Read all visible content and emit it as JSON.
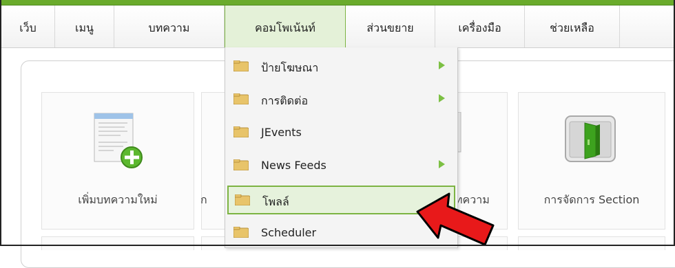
{
  "menu": {
    "items": [
      {
        "label": "เว็บ"
      },
      {
        "label": "เมนู"
      },
      {
        "label": "บทความ"
      },
      {
        "label": "คอมโพเน้นท์"
      },
      {
        "label": "ส่วนขยาย"
      },
      {
        "label": "เครื่องมือ"
      },
      {
        "label": "ช่วยเหลือ"
      }
    ],
    "active_index": 3
  },
  "dropdown": {
    "items": [
      {
        "label": "ป้ายโฆษณา",
        "submenu": true
      },
      {
        "label": "การติดต่อ",
        "submenu": true
      },
      {
        "label": "JEvents",
        "submenu": false
      },
      {
        "label": "News Feeds",
        "submenu": true
      },
      {
        "label": "โพลล์",
        "submenu": false,
        "highlighted": true
      },
      {
        "label": "Scheduler",
        "submenu": false
      }
    ]
  },
  "tiles": [
    {
      "label": "เพิ่มบทความใหม่",
      "icon": "new-article-icon"
    },
    {
      "label": "ก",
      "icon": ""
    },
    {
      "label": "ทความ",
      "icon": "article-manager-icon"
    },
    {
      "label": "การจัดการ Section",
      "icon": "section-manager-icon"
    }
  ],
  "colors": {
    "accent_green": "#6aab2c",
    "highlight_border": "#7cb342",
    "pointer_arrow": "#e8191a"
  }
}
